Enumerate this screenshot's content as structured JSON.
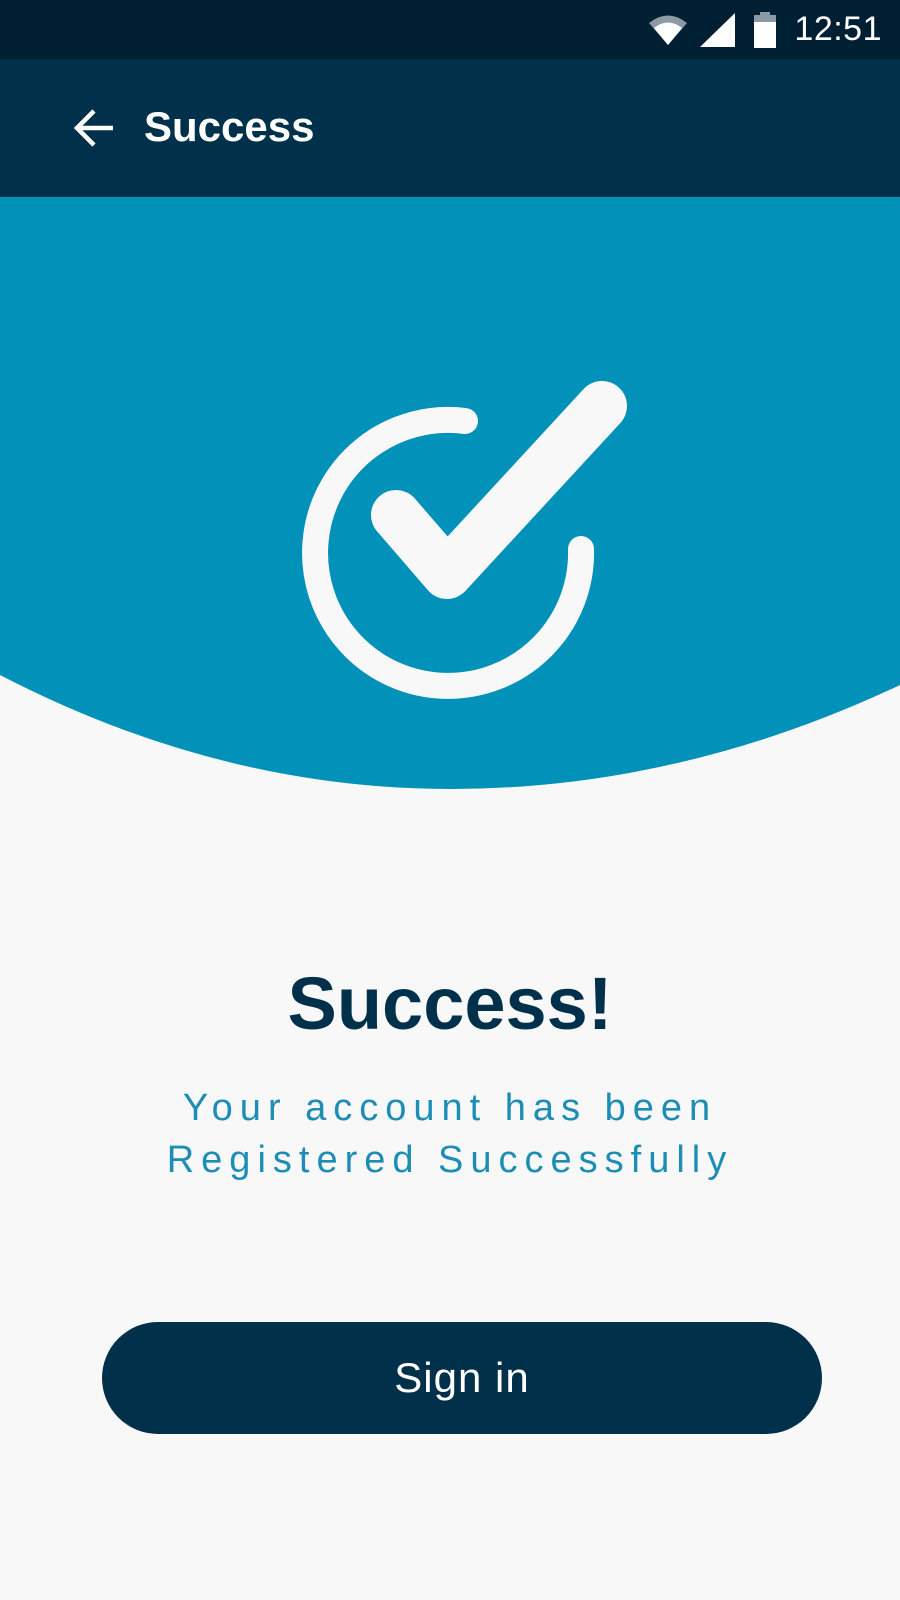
{
  "status_bar": {
    "time": "12:51",
    "icons": [
      "wifi-icon",
      "signal-icon",
      "battery-icon"
    ]
  },
  "app_bar": {
    "back_icon": "arrow-left-icon",
    "title": "Success"
  },
  "hero": {
    "icon": "check-circle-icon",
    "background_color": "#0191b9"
  },
  "content": {
    "headline": "Success!",
    "subtitle_line1": "Your account has been",
    "subtitle_line2": "Registered Successfully"
  },
  "actions": {
    "signin_label": "Sign in"
  },
  "colors": {
    "status_bar": "#001f33",
    "app_bar": "#00304a",
    "accent": "#0191b9",
    "subtitle": "#1c8eb5",
    "background": "#f8f8f9"
  }
}
